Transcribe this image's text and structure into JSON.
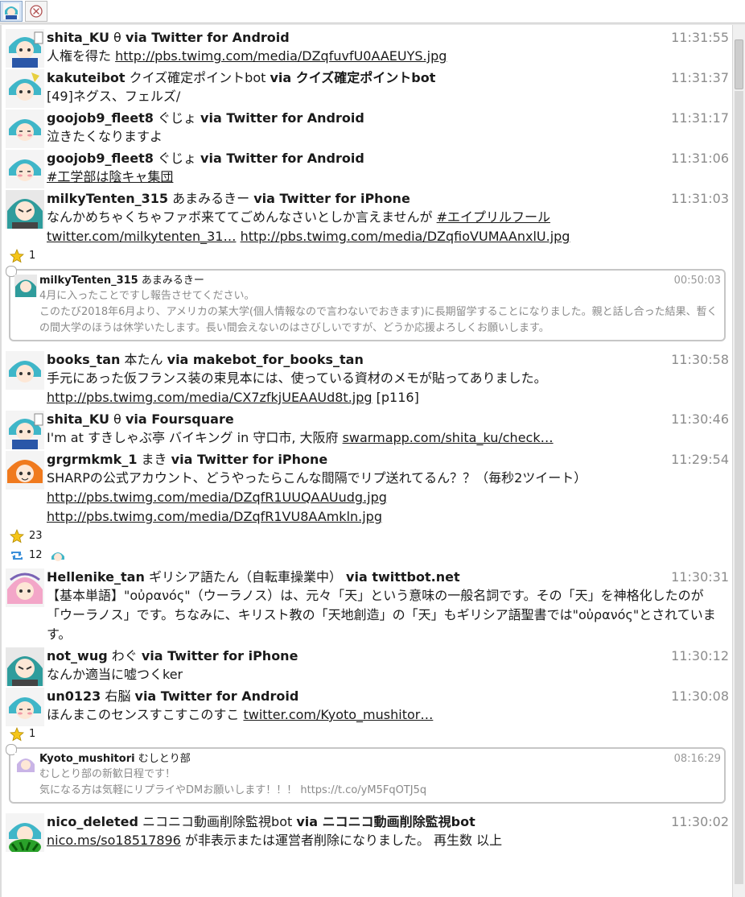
{
  "colors": {
    "accent": "#1a1a1a",
    "time": "#8c8c8c",
    "star": "#f5c518",
    "retweet": "#3b8fd9"
  },
  "icons": {
    "favorite": "star-icon",
    "retweet": "retweet-icon",
    "close": "close-icon"
  },
  "tweets": [
    {
      "screen_name": "shita_KU",
      "name": "θ",
      "via": "via Twitter for Android",
      "time": "11:31:55",
      "t1": "人権を得た ",
      "l1": "http://pbs.twimg.com/media/DZqfuvfU0AAEUYS.jpg"
    },
    {
      "screen_name": "kakuteibot",
      "name": "クイズ確定ポイントbot",
      "via": "via クイズ確定ポイントbot",
      "time": "11:31:37",
      "t1": "[49]ネグス、フェルズ/"
    },
    {
      "screen_name": "goojob9_fleet8",
      "name": "ぐじょ",
      "via": "via Twitter for Android",
      "time": "11:31:17",
      "t1": "泣きたくなりますよ"
    },
    {
      "screen_name": "goojob9_fleet8",
      "name": "ぐじょ",
      "via": "via Twitter for Android",
      "time": "11:31:06",
      "l1": "#工学部は陰キャ集団"
    },
    {
      "screen_name": "milkyTenten_315",
      "name": "あまみるきー",
      "via": "via Twitter for iPhone",
      "time": "11:31:03",
      "t1": "なんかめちゃくちゃファボ来ててごめんなさいとしか言えませんが ",
      "l1": "#エイプリルフール",
      "l2": "twitter.com/milkytenten_31…",
      "l3": "http://pbs.twimg.com/media/DZqfioVUMAAnxlU.jpg",
      "fav": "1",
      "quote": {
        "screen_name": "milkyTenten_315",
        "name": "あまみるきー",
        "time": "00:50:03",
        "l1": "4月に入ったことですし報告させてください。",
        "l2": "このたび2018年6月より、アメリカの某大学(個人情報なので言わないでおきます)に長期留学することになりました。親と話し合った結果、暫くの間大学のほうは休学いたします。長い間会えないのはさびしいですが、どうか応援よろしくお願いします。"
      }
    },
    {
      "screen_name": "books_tan",
      "name": "本たん",
      "via": "via makebot_for_books_tan",
      "time": "11:30:58",
      "t1": "手元にあった仮フランス装の束見本には、使っている資材のメモが貼ってありました。 ",
      "l1": "http://pbs.twimg.com/media/CX7zfkjUEAAUd8t.jpg",
      "t2": " [p116]"
    },
    {
      "screen_name": "shita_KU",
      "name": "θ",
      "via": "via Foursquare",
      "time": "11:30:46",
      "t1": "I'm at すきしゃぶ亭 バイキング in 守口市, 大阪府 ",
      "l1": "swarmapp.com/shita_ku/check…"
    },
    {
      "screen_name": "grgrmkmk_1",
      "name": "まき",
      "via": "via Twitter for iPhone",
      "time": "11:29:54",
      "t1": "SHARPの公式アカウント、どうやったらこんな間隔でリプ送れてるん？？（毎秒2ツイート） ",
      "l1": "http://pbs.twimg.com/media/DZqfR1UUQAAUudg.jpg",
      "l2": "http://pbs.twimg.com/media/DZqfR1VU8AAmkln.jpg",
      "fav": "23",
      "rt": "12"
    },
    {
      "screen_name": "Hellenike_tan",
      "name": "ギリシア語たん（自転車操業中）",
      "via": "via twittbot.net",
      "time": "11:30:31",
      "t1": "【基本単語】\"οὐρανός\"（ウーラノス）は、元々「天」という意味の一般名詞です。その「天」を神格化したのが「ウーラノス」です。ちなみに、キリスト教の「天地創造」の「天」もギリシア語聖書では\"οὐρανός\"とされています。"
    },
    {
      "screen_name": "not_wug",
      "name": "わぐ",
      "via": "via Twitter for iPhone",
      "time": "11:30:12",
      "t1": "なんか適当に嘘つくker"
    },
    {
      "screen_name": "un0123",
      "name": "右脳",
      "via": "via Twitter for Android",
      "time": "11:30:08",
      "t1": "ほんまこのセンスすこすこのすこ ",
      "l1": "twitter.com/Kyoto_mushitor…",
      "fav": "1",
      "quote": {
        "screen_name": "Kyoto_mushitori",
        "name": "むしとり部",
        "time": "08:16:29",
        "l1": "むしとり部の新歓日程です！",
        "l2": "気になる方は気軽にリプライやDMお願いします！！！ https://t.co/yM5FqOTJ5q"
      }
    },
    {
      "screen_name": "nico_deleted",
      "name": "ニコニコ動画削除監視bot",
      "via": "via ニコニコ動画削除監視bot",
      "time": "11:30:02",
      "l1": "nico.ms/so18517896",
      "t1": " が非表示または運営者削除になりました。 再生数  以上"
    }
  ]
}
